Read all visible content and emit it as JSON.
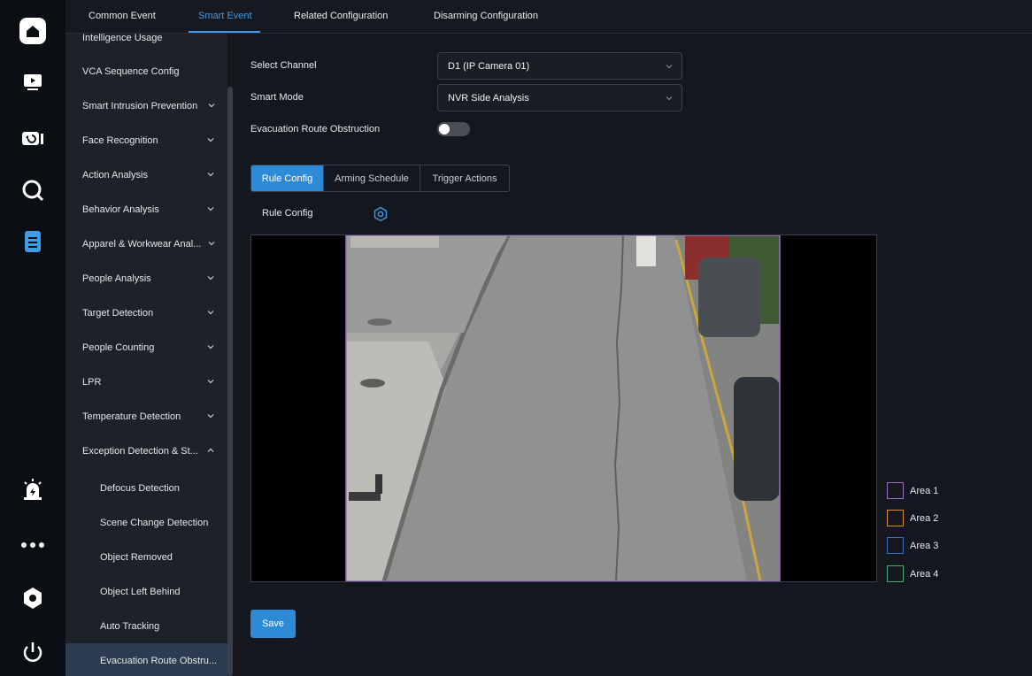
{
  "top_tabs": [
    {
      "label": "Common Event"
    },
    {
      "label": "Smart Event"
    },
    {
      "label": "Related Configuration"
    },
    {
      "label": "Disarming Configuration"
    }
  ],
  "side_menu": {
    "items": [
      {
        "label": "Intelligence Usage",
        "expandable": false
      },
      {
        "label": "VCA Sequence Config",
        "expandable": false
      },
      {
        "label": "Smart Intrusion Prevention",
        "expandable": true
      },
      {
        "label": "Face Recognition",
        "expandable": true
      },
      {
        "label": "Action Analysis",
        "expandable": true
      },
      {
        "label": "Behavior Analysis",
        "expandable": true
      },
      {
        "label": "Apparel & Workwear Anal...",
        "expandable": true
      },
      {
        "label": "People Analysis",
        "expandable": true
      },
      {
        "label": "Target Detection",
        "expandable": true
      },
      {
        "label": "People Counting",
        "expandable": true
      },
      {
        "label": "LPR",
        "expandable": true
      },
      {
        "label": "Temperature Detection",
        "expandable": true
      },
      {
        "label": "Exception Detection & St...",
        "expandable": true,
        "expanded": true
      }
    ],
    "sub_items": [
      {
        "label": "Defocus Detection"
      },
      {
        "label": "Scene Change Detection"
      },
      {
        "label": "Object Removed"
      },
      {
        "label": "Object Left Behind"
      },
      {
        "label": "Auto Tracking"
      },
      {
        "label": "Evacuation Route Obstru...",
        "active": true
      }
    ]
  },
  "form": {
    "channel_label": "Select Channel",
    "channel_value": "D1 (IP Camera 01)",
    "mode_label": "Smart Mode",
    "mode_value": "NVR Side Analysis",
    "evacuation_label": "Evacuation Route Obstruction",
    "evacuation_enabled": false
  },
  "sub_tabs": [
    {
      "label": "Rule Config",
      "active": true
    },
    {
      "label": "Arming Schedule"
    },
    {
      "label": "Trigger Actions"
    }
  ],
  "rule_config_label": "Rule Config",
  "areas": [
    {
      "label": "Area 1",
      "color": "#9b6fc8"
    },
    {
      "label": "Area 2",
      "color": "#d98a3a"
    },
    {
      "label": "Area 3",
      "color": "#3b72c8"
    },
    {
      "label": "Area 4",
      "color": "#3fae7a"
    }
  ],
  "save_label": "Save",
  "colors": {
    "accent": "#2d8ad6",
    "active_tab_text": "#3d9be9",
    "active_menu_bg": "#2c3b4d"
  }
}
